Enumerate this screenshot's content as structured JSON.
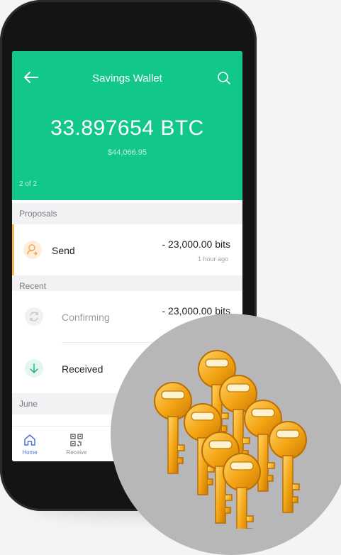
{
  "header": {
    "title": "Savings Wallet",
    "balance": "33.897654 BTC",
    "fiat": "$44,066.95",
    "pager": "2 of 2"
  },
  "sections": {
    "proposals": "Proposals",
    "recent": "Recent",
    "june": "June"
  },
  "proposal": {
    "label": "Send",
    "amount": "- 23,000.00 bits",
    "time": "1 hour ago"
  },
  "recent": [
    {
      "label": "Confirming",
      "amount": "- 23,000.00 bits"
    },
    {
      "label": "Received"
    }
  ],
  "tabs": [
    {
      "label": "Home"
    },
    {
      "label": "Receive"
    }
  ],
  "colors": {
    "header_green": "#12c78b",
    "proposal_accent": "#f4b65b",
    "active_tab": "#4c73d6",
    "key_gold": "#f0a20f"
  },
  "icons": [
    "back-arrow-icon",
    "search-icon",
    "send-proposal-icon",
    "confirming-sync-icon",
    "received-arrow-icon",
    "home-icon",
    "qr-code-icon",
    "keys-icon"
  ]
}
